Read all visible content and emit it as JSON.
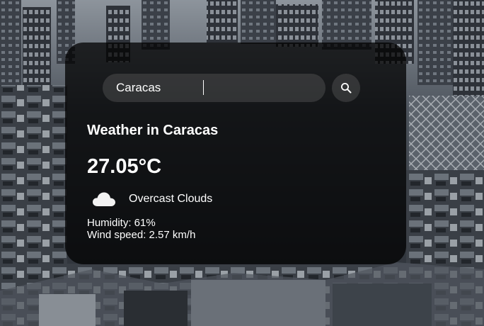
{
  "search": {
    "value": "Caracas",
    "placeholder": ""
  },
  "icons": {
    "search": "search-icon",
    "weather": "cloud-icon"
  },
  "weather": {
    "title": "Weather in Caracas",
    "temperature": "27.05°C",
    "description": "Overcast Clouds",
    "humidity": "Humidity: 61%",
    "wind": "Wind speed: 2.57 km/h"
  },
  "colors": {
    "card_background": "#000000",
    "text": "#ffffff",
    "input_background": "#7c7c7c"
  }
}
